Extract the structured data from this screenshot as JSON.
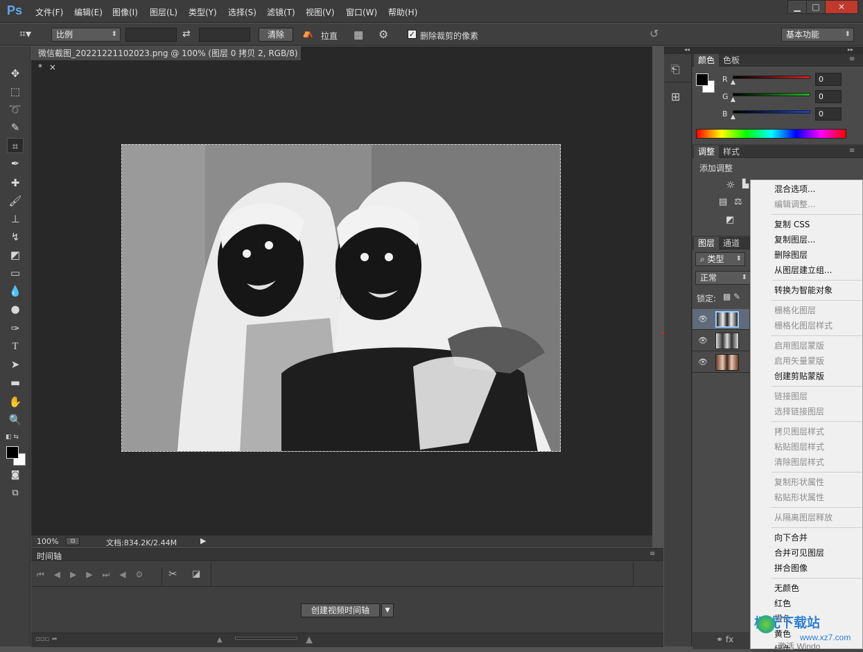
{
  "app": {
    "logo": "Ps",
    "menu": [
      "文件(F)",
      "编辑(E)",
      "图像(I)",
      "图层(L)",
      "类型(Y)",
      "选择(S)",
      "滤镜(T)",
      "视图(V)",
      "窗口(W)",
      "帮助(H)"
    ],
    "window_buttons": [
      "▁",
      "□",
      "✕"
    ]
  },
  "options": {
    "ratio_select": "比例",
    "clear_label": "清除",
    "straighten_label": "拉直",
    "delete_cropped_label": "删除裁剪的像素",
    "delete_cropped_checked": true,
    "workspace_select": "基本功能"
  },
  "document": {
    "tab_title": "微信截图_20221221102023.png @ 100% (图层 0 拷贝 2, RGB/8) *",
    "tab_close": "×",
    "zoom": "100%",
    "doc_info": "文档:834.2K/2.44M"
  },
  "timeline": {
    "title": "时间轴",
    "create_button": "创建视频时间轴"
  },
  "panels": {
    "color_tabs": [
      "颜色",
      "色板"
    ],
    "rgb": [
      {
        "label": "R",
        "value": "0",
        "color": "#d42020"
      },
      {
        "label": "G",
        "value": "0",
        "color": "#20b020"
      },
      {
        "label": "B",
        "value": "0",
        "color": "#2040d0"
      }
    ],
    "adjust_tabs": [
      "调整",
      "样式"
    ],
    "add_adjustment": "添加调整",
    "layers_tabs": [
      "图层",
      "通道"
    ],
    "filter_kind": "类型",
    "blend_mode": "正常",
    "lock_label": "锁定:"
  },
  "context_menu": {
    "items": [
      {
        "label": "混合选项...",
        "disabled": false
      },
      {
        "label": "编辑调整...",
        "disabled": true
      },
      {
        "sep": true
      },
      {
        "label": "复制 CSS",
        "disabled": false
      },
      {
        "label": "复制图层...",
        "disabled": false
      },
      {
        "label": "删除图层",
        "disabled": false
      },
      {
        "label": "从图层建立组...",
        "disabled": false
      },
      {
        "sep": true
      },
      {
        "label": "转换为智能对象",
        "disabled": false
      },
      {
        "sep": true
      },
      {
        "label": "栅格化图层",
        "disabled": true
      },
      {
        "label": "栅格化图层样式",
        "disabled": true
      },
      {
        "sep": true
      },
      {
        "label": "启用图层蒙版",
        "disabled": true
      },
      {
        "label": "启用矢量蒙版",
        "disabled": true
      },
      {
        "label": "创建剪贴蒙版",
        "disabled": false
      },
      {
        "sep": true
      },
      {
        "label": "链接图层",
        "disabled": true
      },
      {
        "label": "选择链接图层",
        "disabled": true
      },
      {
        "sep": true
      },
      {
        "label": "拷贝图层样式",
        "disabled": true
      },
      {
        "label": "粘贴图层样式",
        "disabled": true
      },
      {
        "label": "清除图层样式",
        "disabled": true
      },
      {
        "sep": true
      },
      {
        "label": "复制形状属性",
        "disabled": true
      },
      {
        "label": "粘贴形状属性",
        "disabled": true
      },
      {
        "sep": true
      },
      {
        "label": "从隔离图层释放",
        "disabled": true
      },
      {
        "sep": true
      },
      {
        "label": "向下合并",
        "disabled": false
      },
      {
        "label": "合并可见图层",
        "disabled": false
      },
      {
        "label": "拼合图像",
        "disabled": false
      },
      {
        "sep": true
      },
      {
        "label": "无颜色",
        "disabled": false
      },
      {
        "label": "红色",
        "disabled": false
      },
      {
        "label": "橙色",
        "disabled": false
      },
      {
        "label": "黄色",
        "disabled": false
      },
      {
        "label": "绿色",
        "disabled": false
      }
    ]
  },
  "watermark": {
    "text": "极光下载站",
    "url": "www.xz7.com",
    "os_text": "激活 Windo"
  },
  "colors": {
    "accent": "#5ea9f0",
    "arrow": "#e02020"
  }
}
